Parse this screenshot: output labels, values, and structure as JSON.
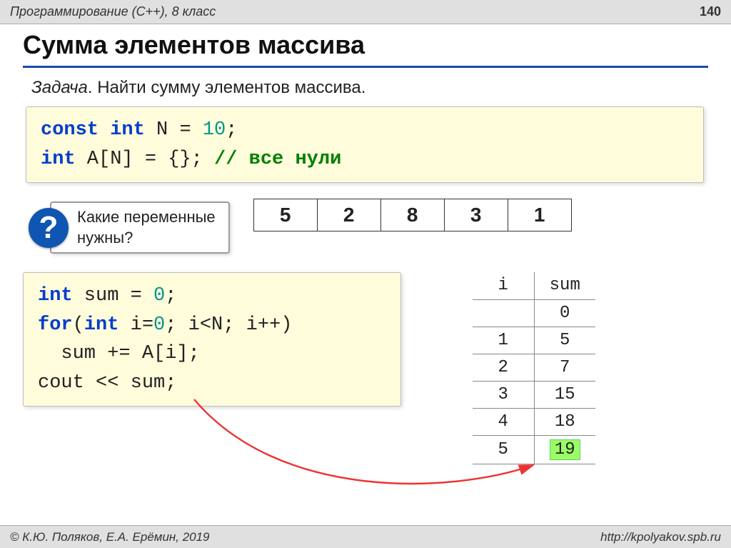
{
  "header": {
    "course": "Программирование (C++), 8 класс",
    "page_number": "140"
  },
  "title": "Сумма элементов массива",
  "task": {
    "label": "Задача",
    "text": ". Найти сумму элементов массива."
  },
  "code_top": {
    "line1": {
      "kw_const": "const",
      "kw_int": "int",
      "var": "N",
      "eq": "=",
      "val": "10",
      "semi": ";"
    },
    "line2": {
      "kw_int": "int",
      "rest": " A[N] = {};  ",
      "comment": "// все нули"
    }
  },
  "question": {
    "mark": "?",
    "text_l1": "Какие переменные",
    "text_l2": "нужны?"
  },
  "array_values": [
    "5",
    "2",
    "8",
    "3",
    "1"
  ],
  "code_bottom": {
    "l1": {
      "kw_int": "int",
      "rest": " sum = ",
      "zero": "0",
      "semi": ";"
    },
    "l2": {
      "kw_for": "for",
      "paren": "(",
      "kw_int2": "int",
      "rest2": " i=",
      "zero2": "0",
      "rest3": "; i<N; i++)"
    },
    "l3": {
      "body": "  sum += A[i];"
    },
    "l4": {
      "cout": "cout << sum;"
    }
  },
  "trace": {
    "headers": {
      "i": "i",
      "sum": "sum"
    },
    "rows": [
      {
        "i": "",
        "sum": "0"
      },
      {
        "i": "1",
        "sum": "5"
      },
      {
        "i": "2",
        "sum": "7"
      },
      {
        "i": "3",
        "sum": "15"
      },
      {
        "i": "4",
        "sum": "18"
      },
      {
        "i": "5",
        "sum": "19",
        "final": true
      }
    ]
  },
  "footer": {
    "left": "© К.Ю. Поляков, Е.А. Ерёмин, 2019",
    "right": "http://kpolyakov.spb.ru"
  }
}
